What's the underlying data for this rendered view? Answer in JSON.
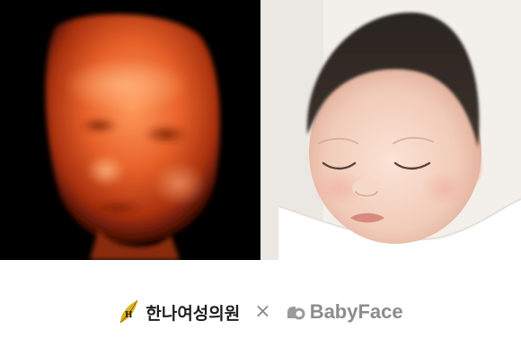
{
  "photos": {
    "left": "ultrasound-3d-fetal-face",
    "right": "newborn-sleeping-photo"
  },
  "brands": {
    "partner_name": "한나여성의원",
    "partner_logo_icon": "hana-leaf-logo-icon",
    "separator": "×",
    "product_name": "BabyFace",
    "product_logo_icon": "babyface-logo-icon"
  },
  "colors": {
    "ultrasound_accent": "#e8622a",
    "partner_gold": "#d9b21a",
    "product_gray": "#8c8c8c",
    "text_dark": "#1e1e1e"
  }
}
